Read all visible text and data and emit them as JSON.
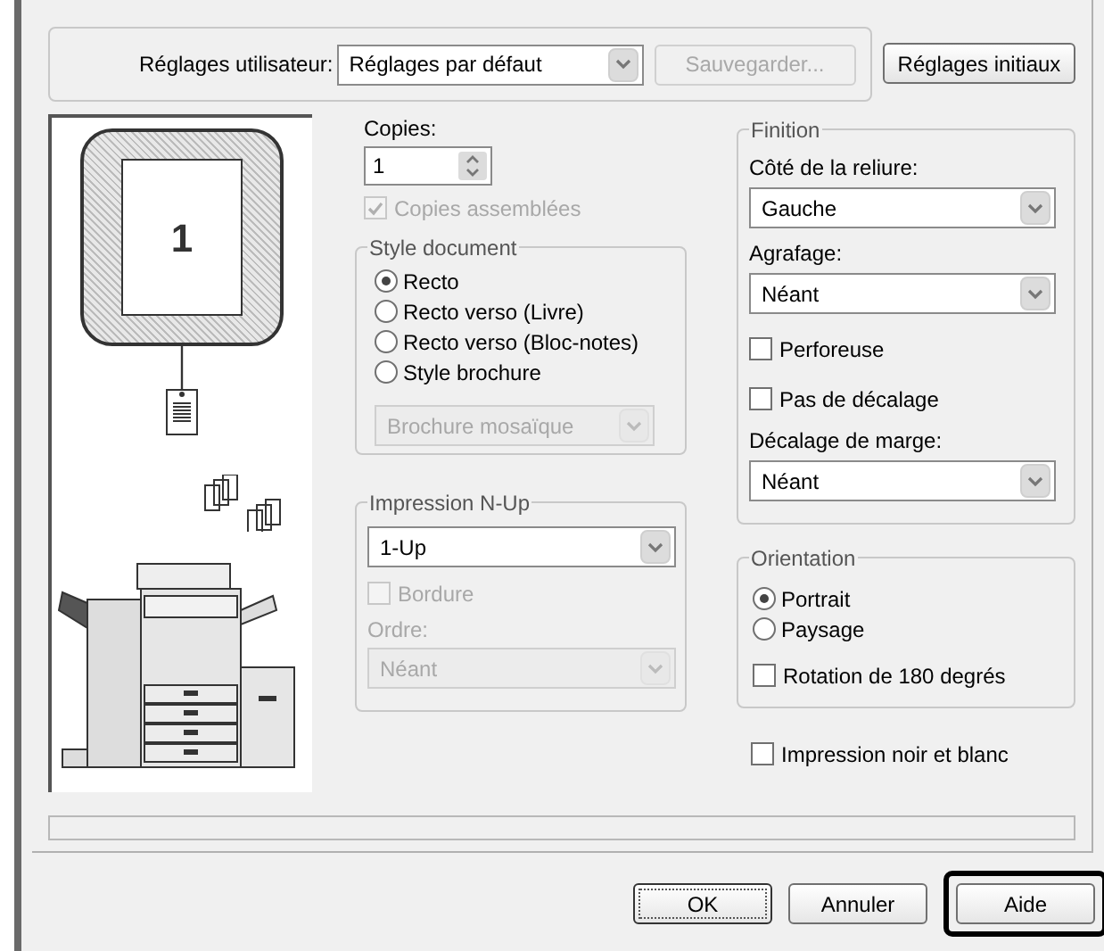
{
  "user_settings": {
    "label": "Réglages utilisateur:",
    "value": "Réglages par défaut",
    "save_button": {
      "label": "Sauvegarder...",
      "disabled": true
    },
    "reset_button": {
      "label": "Réglages initiaux"
    }
  },
  "preview": {
    "page_number": "1"
  },
  "copies": {
    "label": "Copies:",
    "value": "1",
    "collate": {
      "label": "Copies assemblées",
      "checked": true,
      "disabled": true
    }
  },
  "document_style": {
    "title": "Style document",
    "options": [
      {
        "label": "Recto",
        "selected": true
      },
      {
        "label": "Recto verso (Livre)",
        "selected": false
      },
      {
        "label": "Recto verso (Bloc-notes)",
        "selected": false
      },
      {
        "label": "Style brochure",
        "selected": false
      }
    ],
    "booklet": {
      "value": "Brochure mosaïque",
      "disabled": true
    }
  },
  "n_up": {
    "title": "Impression N-Up",
    "value": "1-Up",
    "border": {
      "label": "Bordure",
      "checked": false,
      "disabled": true
    },
    "order": {
      "label": "Ordre:",
      "value": "Néant",
      "disabled": true
    }
  },
  "finishing": {
    "title": "Finition",
    "binding": {
      "label": "Côté de la reliure:",
      "value": "Gauche"
    },
    "stapling": {
      "label": "Agrafage:",
      "value": "Néant"
    },
    "punch": {
      "label": "Perforeuse",
      "checked": false
    },
    "no_offset": {
      "label": "Pas de décalage",
      "checked": false
    },
    "margin_shift": {
      "label": "Décalage de marge:",
      "value": "Néant"
    }
  },
  "orientation": {
    "title": "Orientation",
    "options": [
      {
        "label": "Portrait",
        "selected": true
      },
      {
        "label": "Paysage",
        "selected": false
      }
    ],
    "rotate": {
      "label": "Rotation de 180 degrés",
      "checked": false
    }
  },
  "black_white": {
    "label": "Impression noir et blanc",
    "checked": false
  },
  "buttons": [
    {
      "label": "OK",
      "default": true,
      "highlighted": false
    },
    {
      "label": "Annuler",
      "default": false,
      "highlighted": false
    },
    {
      "label": "Aide",
      "default": false,
      "highlighted": true
    }
  ]
}
